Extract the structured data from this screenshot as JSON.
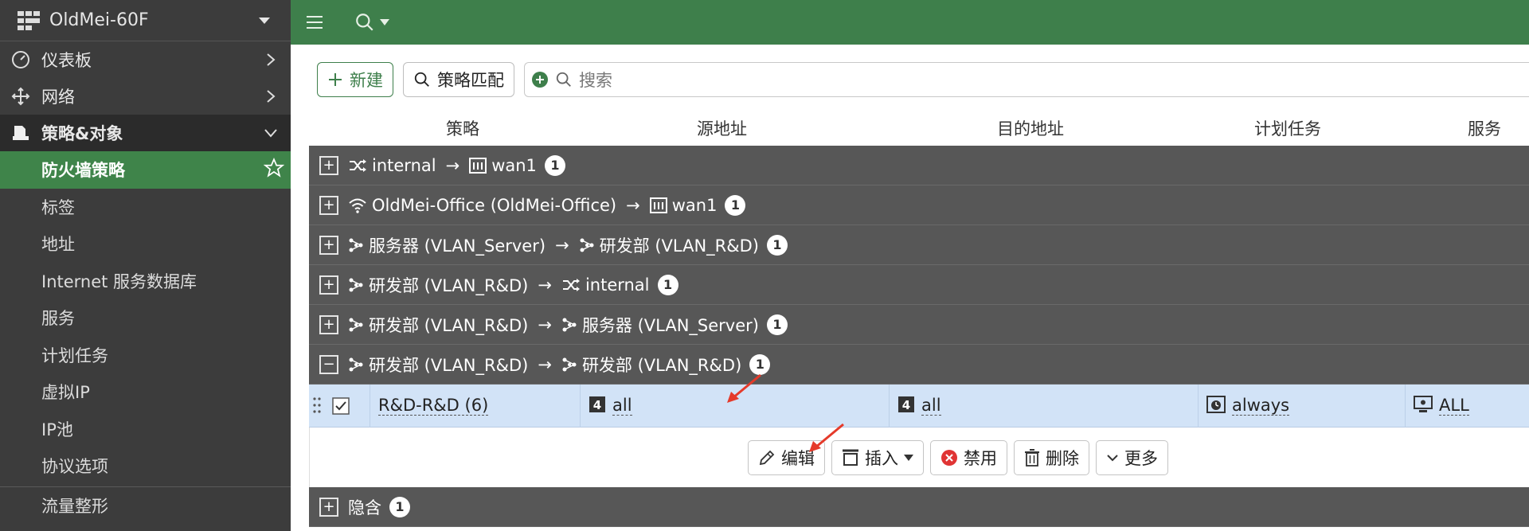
{
  "sidebar": {
    "device_name": "OldMei-60F",
    "items": [
      {
        "label": "仪表板",
        "icon": "dashboard-icon"
      },
      {
        "label": "网络",
        "icon": "network-move-icon"
      },
      {
        "label": "策略&对象",
        "icon": "policy-icon"
      }
    ],
    "subitems": [
      "防火墙策略",
      "标签",
      "地址",
      "Internet 服务数据库",
      "服务",
      "计划任务",
      "虚拟IP",
      "IP池",
      "协议选项"
    ],
    "bottom_item": "流量整形"
  },
  "toolbar": {
    "new_label": "新建",
    "policy_match_label": "策略匹配",
    "search_placeholder": "搜索"
  },
  "columns": [
    "策略",
    "源地址",
    "目的地址",
    "计划任务",
    "服务"
  ],
  "groups": [
    {
      "src": "internal",
      "dst": "wan1",
      "count": "1"
    },
    {
      "src": "OldMei-Office (OldMei-Office)",
      "dst": "wan1",
      "count": "1"
    },
    {
      "src": "服务器 (VLAN_Server)",
      "dst": "研发部 (VLAN_R&D)",
      "count": "1"
    },
    {
      "src": "研发部 (VLAN_R&D)",
      "dst": "internal",
      "count": "1"
    },
    {
      "src": "研发部 (VLAN_R&D)",
      "dst": "服务器 (VLAN_Server)",
      "count": "1"
    },
    {
      "src": "研发部 (VLAN_R&D)",
      "dst": "研发部 (VLAN_R&D)",
      "count": "1"
    }
  ],
  "arrow_symbol": "→",
  "policy_row": {
    "name": "R&D-R&D (6)",
    "source": "all",
    "destination": "all",
    "schedule": "always",
    "service": "ALL"
  },
  "actions": {
    "edit": "编辑",
    "insert": "插入",
    "disable": "禁用",
    "delete": "删除",
    "more": "更多"
  },
  "implicit": {
    "label": "隐含",
    "count": "1"
  },
  "colors": {
    "sidebar_bg": "#3c3c3c",
    "accent_green": "#3e7f4b",
    "group_bg": "#575757",
    "selected_row": "#d2e3f7",
    "annotation_red": "#e53a2a"
  }
}
